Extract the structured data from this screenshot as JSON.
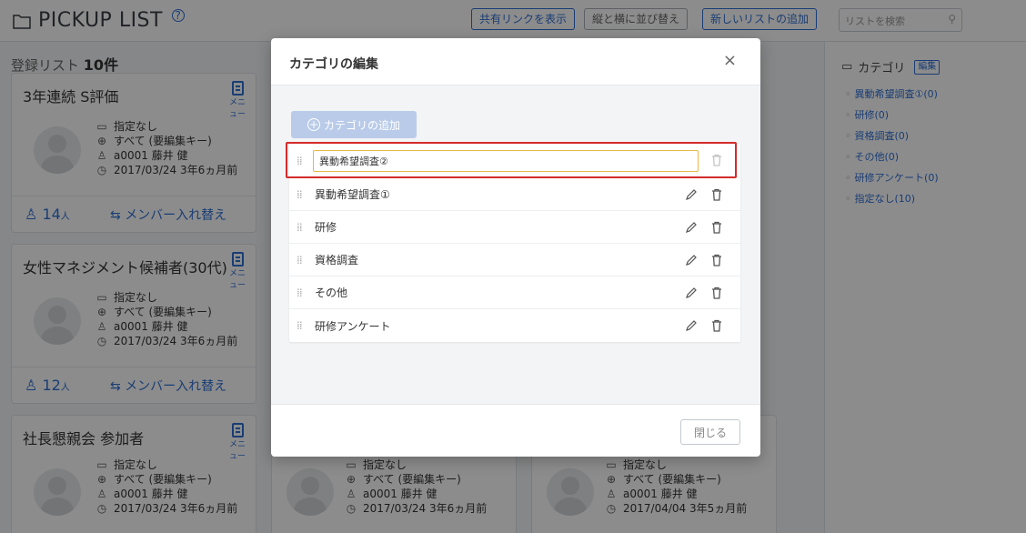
{
  "header": {
    "title": "PICKUP LIST",
    "share_link_label": "共有リンクを表示",
    "sort_label": "縦と横に並び替え",
    "add_list_label": "新しいリストの追加",
    "search_placeholder": "リストを検索"
  },
  "list_summary": {
    "label": "登録リスト",
    "count": "10件"
  },
  "cards": [
    {
      "title": "3年連続 S評価",
      "menu_label": "メニュー",
      "category": "指定なし",
      "permission": "すべて (要編集キー)",
      "owner": "a0001 藤井 健",
      "date": "2017/03/24 3年6ヵ月前",
      "member_count": "14",
      "member_unit": "人",
      "swap_label": "メンバー入れ替え"
    },
    {
      "title": "女性マネジメント候補者(30代)",
      "menu_label": "メニュー",
      "category": "指定なし",
      "permission": "すべて (要編集キー)",
      "owner": "a0001 藤井 健",
      "date": "2017/03/24 3年6ヵ月前",
      "member_count": "12",
      "member_unit": "人",
      "swap_label": "メンバー入れ替え"
    },
    {
      "title": "社長懇親会 参加者",
      "menu_label": "メニュー",
      "category": "指定なし",
      "permission": "すべて (要編集キー)",
      "owner": "a0001 藤井 健",
      "date": "2017/03/24 3年6ヵ月前"
    },
    {
      "category": "指定なし",
      "permission": "すべて (要編集キー)",
      "owner": "a0001 藤井 健",
      "date": "2017/03/24 3年6ヵ月前"
    },
    {
      "category": "指定なし",
      "permission": "すべて (要編集キー)",
      "owner": "a0001 藤井 健",
      "date": "2017/04/04 3年5ヵ月前"
    }
  ],
  "category_panel": {
    "heading": "カテゴリ",
    "edit_label": "編集",
    "items": [
      "異動希望調査①(0)",
      "研修(0)",
      "資格調査(0)",
      "その他(0)",
      "研修アンケート(0)",
      "指定なし(10)"
    ]
  },
  "modal": {
    "title": "カテゴリの編集",
    "close_icon": "×",
    "add_label": "カテゴリの追加",
    "editing_value": "異動希望調査②",
    "categories": [
      "異動希望調査①",
      "研修",
      "資格調査",
      "その他",
      "研修アンケート"
    ],
    "close_button": "閉じる"
  },
  "colors": {
    "accent": "#2f6fd6",
    "highlight": "#d42b2b",
    "input_focus": "#e7b84a"
  }
}
